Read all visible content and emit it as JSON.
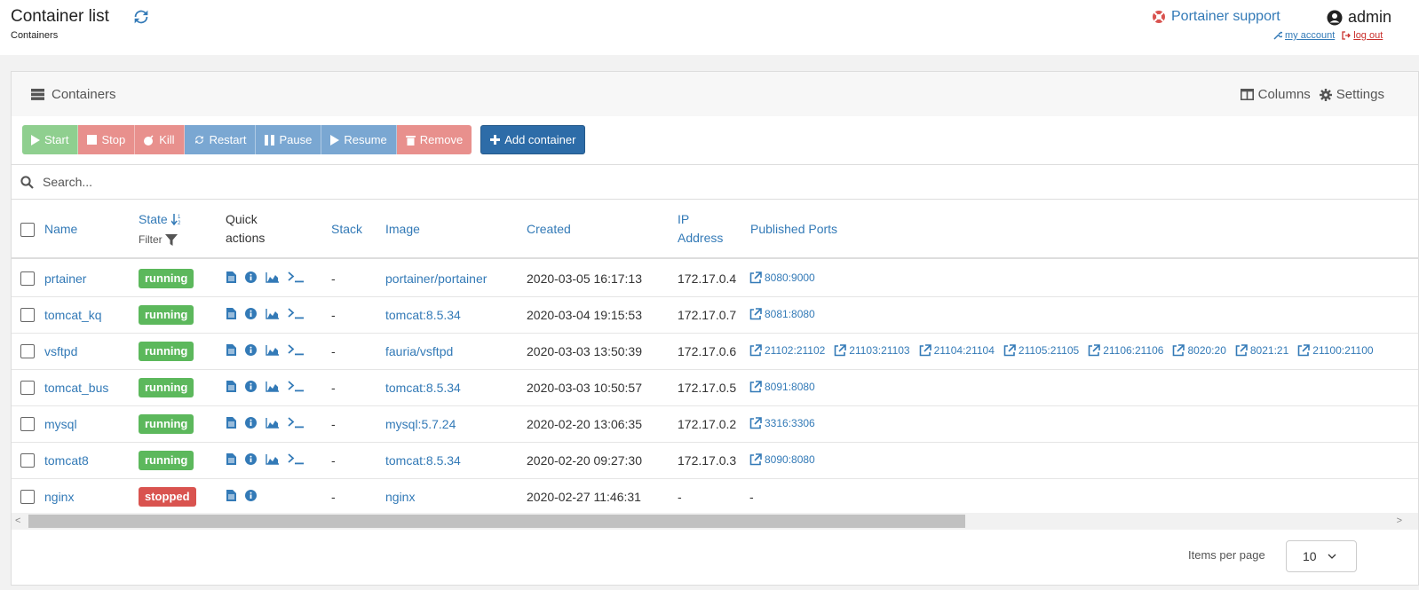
{
  "header": {
    "title": "Container list",
    "breadcrumb": "Containers",
    "support_label": "Portainer support",
    "username": "admin",
    "my_account_label": "my account",
    "log_out_label": "log out"
  },
  "panel": {
    "title": "Containers",
    "columns_label": "Columns",
    "settings_label": "Settings"
  },
  "actions": {
    "start": "Start",
    "stop": "Stop",
    "kill": "Kill",
    "restart": "Restart",
    "pause": "Pause",
    "resume": "Resume",
    "remove": "Remove",
    "add_container": "Add container"
  },
  "search": {
    "placeholder": "Search..."
  },
  "table": {
    "headers": {
      "name": "Name",
      "state": "State",
      "filter": "Filter",
      "quick_actions_1": "Quick",
      "quick_actions_2": "actions",
      "stack": "Stack",
      "image": "Image",
      "created": "Created",
      "ip_1": "IP",
      "ip_2": "Address",
      "ports": "Published Ports"
    },
    "rows": [
      {
        "name": "prtainer",
        "state": "running",
        "stack": "-",
        "image": "portainer/portainer",
        "created": "2020-03-05 16:17:13",
        "ip": "172.17.0.4",
        "ports": [
          "8080:9000"
        ]
      },
      {
        "name": "tomcat_kq",
        "state": "running",
        "stack": "-",
        "image": "tomcat:8.5.34",
        "created": "2020-03-04 19:15:53",
        "ip": "172.17.0.7",
        "ports": [
          "8081:8080"
        ]
      },
      {
        "name": "vsftpd",
        "state": "running",
        "stack": "-",
        "image": "fauria/vsftpd",
        "created": "2020-03-03 13:50:39",
        "ip": "172.17.0.6",
        "ports": [
          "21102:21102",
          "21103:21103",
          "21104:21104",
          "21105:21105",
          "21106:21106",
          "8020:20",
          "8021:21",
          "21100:21100"
        ]
      },
      {
        "name": "tomcat_bus",
        "state": "running",
        "stack": "-",
        "image": "tomcat:8.5.34",
        "created": "2020-03-03 10:50:57",
        "ip": "172.17.0.5",
        "ports": [
          "8091:8080"
        ]
      },
      {
        "name": "mysql",
        "state": "running",
        "stack": "-",
        "image": "mysql:5.7.24",
        "created": "2020-02-20 13:06:35",
        "ip": "172.17.0.2",
        "ports": [
          "3316:3306"
        ]
      },
      {
        "name": "tomcat8",
        "state": "running",
        "stack": "-",
        "image": "tomcat:8.5.34",
        "created": "2020-02-20 09:27:30",
        "ip": "172.17.0.3",
        "ports": [
          "8090:8080"
        ]
      },
      {
        "name": "nginx",
        "state": "stopped",
        "stack": "-",
        "image": "nginx",
        "created": "2020-02-27 11:46:31",
        "ip": "-",
        "ports": [],
        "ports_empty": "-"
      }
    ]
  },
  "footer": {
    "items_per_page_label": "Items per page",
    "items_per_page_value": "10"
  },
  "colors": {
    "primary": "#337ab7",
    "running": "#5cb85c",
    "stopped": "#d9534f"
  }
}
